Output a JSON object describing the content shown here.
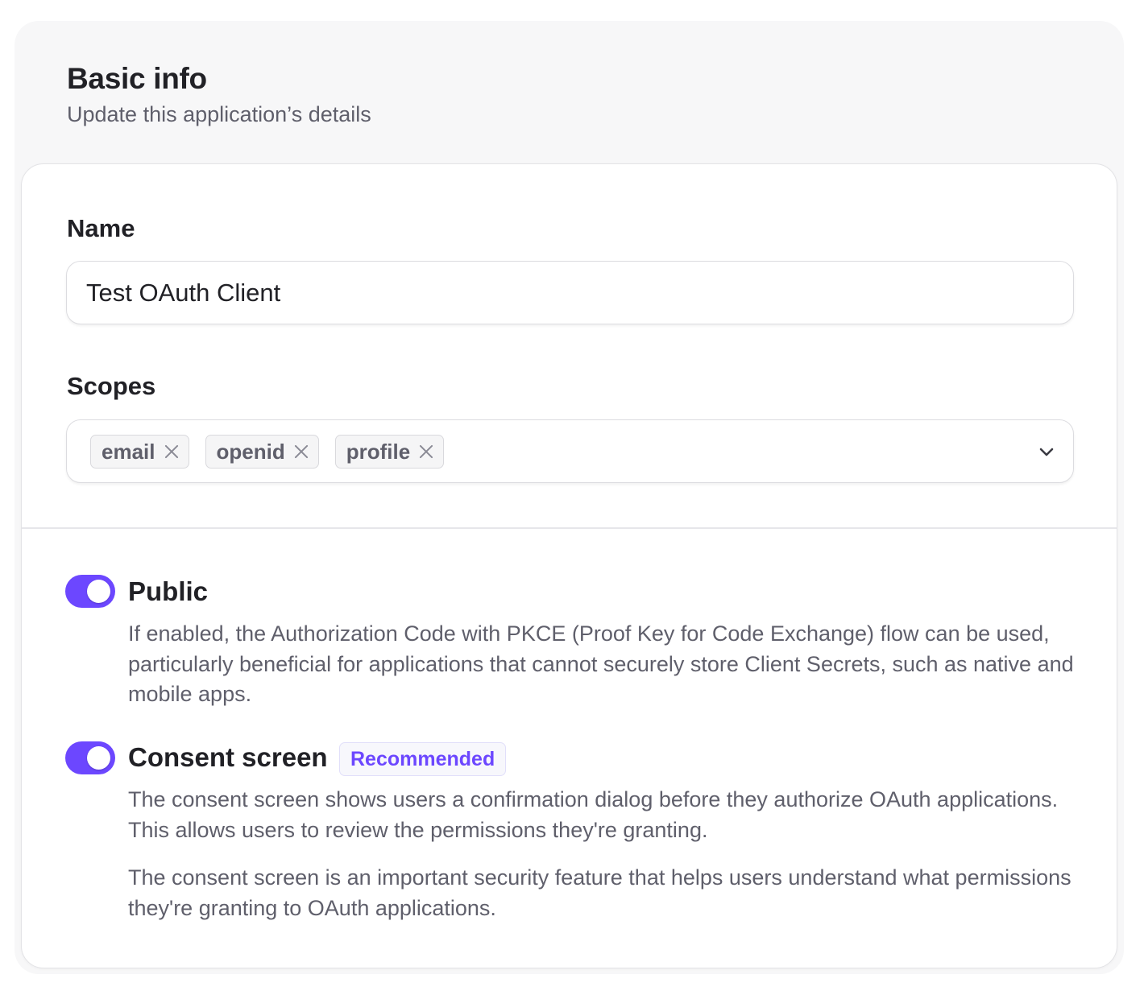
{
  "header": {
    "title": "Basic info",
    "subtitle": "Update this application’s details"
  },
  "name_field": {
    "label": "Name",
    "value": "Test OAuth Client"
  },
  "scopes_field": {
    "label": "Scopes",
    "chips": [
      "email",
      "openid",
      "profile"
    ]
  },
  "options": {
    "public": {
      "title": "Public",
      "enabled": true,
      "description": "If enabled, the Authorization Code with PKCE (Proof Key for Code Exchange) flow can be used, particularly beneficial for applications that cannot securely store Client Secrets, such as native and mobile apps."
    },
    "consent": {
      "title": "Consent screen",
      "enabled": true,
      "badge": "Recommended",
      "description": "The consent screen shows users a confirmation dialog before they authorize OAuth applications. This allows users to review the permissions they're granting.",
      "note": "The consent screen is an important security feature that helps users understand what permissions they're granting to OAuth applications."
    }
  },
  "colors": {
    "accent": "#6c47ff",
    "text_primary": "#212126",
    "text_secondary": "#5f5f6b"
  },
  "icons": {
    "chip_remove": "close-icon",
    "dropdown": "chevron-down-icon"
  }
}
